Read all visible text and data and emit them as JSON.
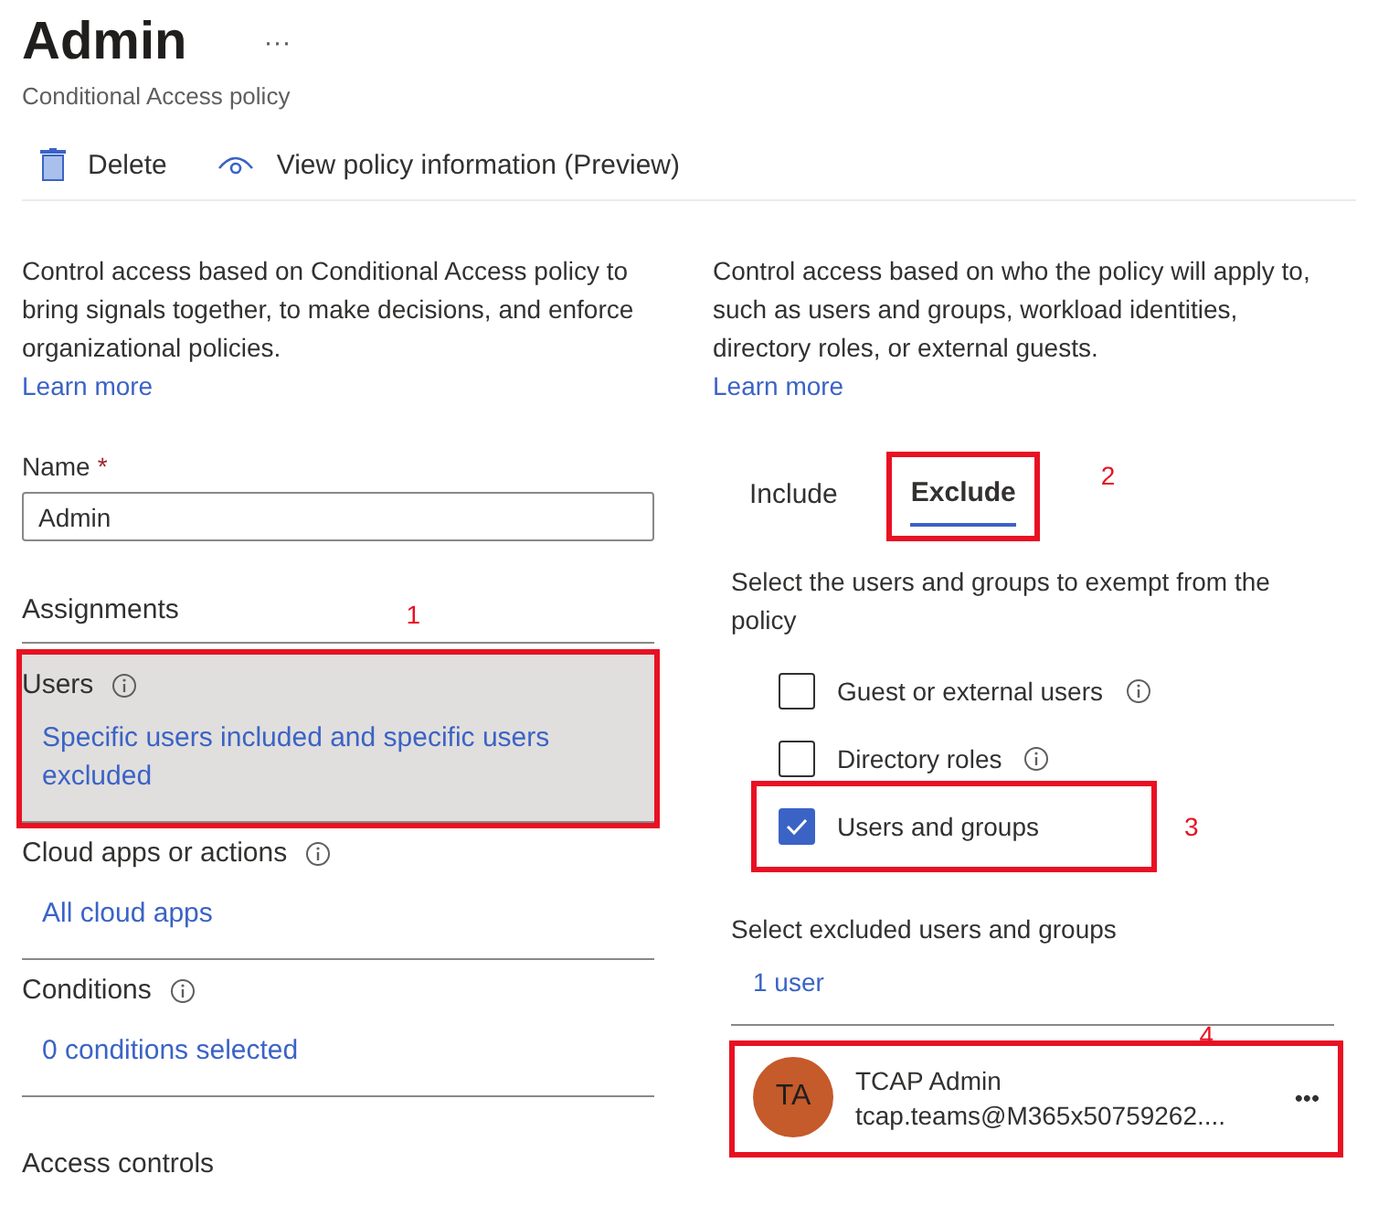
{
  "header": {
    "title": "Admin",
    "more": "···",
    "subtitle": "Conditional Access policy"
  },
  "toolbar": [
    {
      "kind": "delete",
      "label": "Delete"
    },
    {
      "kind": "view",
      "label": "View policy information (Preview)"
    }
  ],
  "left": {
    "description": "Control access based on Conditional Access policy to bring signals together, to make decisions, and enforce organizational policies.",
    "link": "Learn more",
    "name_label": "Name",
    "required_mark": "*",
    "name_value": "Admin",
    "assignments": "Assignments",
    "sections": [
      {
        "title": "Users",
        "value": "Specific users included and specific users excluded",
        "selected": true,
        "annotation": "1"
      },
      {
        "title": "Cloud apps or actions",
        "value": "All cloud apps",
        "selected": false
      },
      {
        "title": "Conditions",
        "value": "0 conditions selected",
        "selected": false
      }
    ],
    "access_controls": "Access controls"
  },
  "right": {
    "description": "Control access based on who the policy will apply to, such as users and groups, workload identities, directory roles, or external guests.",
    "link": "Learn more",
    "tabs": [
      {
        "label": "Include",
        "selected": false
      },
      {
        "label": "Exclude",
        "selected": true,
        "annotation": "2"
      }
    ],
    "instruction": "Select the users and groups to exempt from the policy",
    "options": [
      {
        "label": "Guest or external users",
        "checked": false,
        "info": true
      },
      {
        "label": "Directory roles",
        "checked": false,
        "info": true
      },
      {
        "label": "Users and groups",
        "checked": true,
        "info": false,
        "annotation": "3"
      }
    ],
    "excluded_label": "Select excluded users and groups",
    "excluded_count": "1 user",
    "users": [
      {
        "initials": "TA",
        "name": "TCAP Admin",
        "email": "tcap.teams@M365x50759262....",
        "more": "•••",
        "annotation": "4"
      }
    ]
  }
}
